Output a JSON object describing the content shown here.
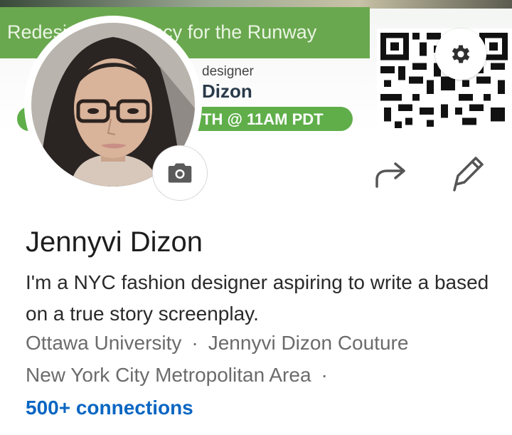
{
  "banner": {
    "title": "Redesigning Agency for the Runway",
    "subtitle_1": "designer",
    "subtitle_2": "Dizon",
    "pill_text": "TH @ 11AM PDT"
  },
  "profile": {
    "name": "Jennyvi Dizon",
    "headline": "I'm a NYC fashion designer aspiring to write a based on a true story screenplay.",
    "education": "Ottawa University",
    "company": "Jennyvi Dizon Couture",
    "location": "New York City Metropolitan Area",
    "separator": "·",
    "connections": "500+ connections"
  },
  "icons": {
    "settings": "gear-icon",
    "camera": "camera-icon",
    "share": "share-arrow-icon",
    "edit": "pencil-icon"
  },
  "colors": {
    "link": "#0a66c2",
    "banner_green": "#6aa84f",
    "text_primary": "#1d1d1d",
    "text_secondary": "#6b6b6b"
  }
}
